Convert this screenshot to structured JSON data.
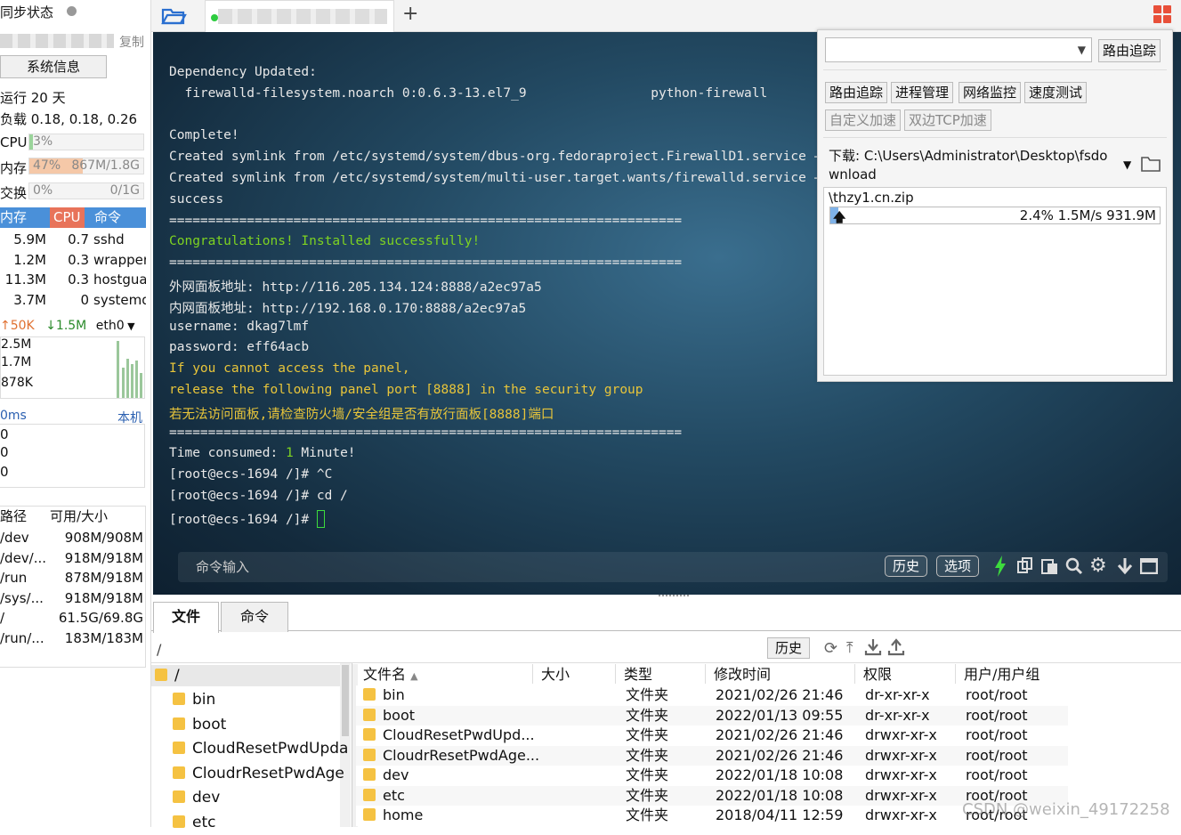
{
  "left": {
    "sync_label": "同步状态",
    "copy_label": "复制",
    "sysinfo_button": "系统信息",
    "uptime": "运行 20 天",
    "load": "负载 0.18, 0.18, 0.26",
    "cpu": {
      "label": "CPU",
      "value": "3%",
      "percent": 3
    },
    "mem": {
      "label": "内存",
      "value": "47%",
      "detail": "867M/1.8G",
      "percent": 47
    },
    "swap": {
      "label": "交换",
      "value": "0%",
      "detail": "0/1G",
      "percent": 0
    },
    "proc_headers": [
      "内存",
      "CPU",
      "命令"
    ],
    "processes": [
      {
        "mem": "5.9M",
        "cpu": "0.7",
        "cmd": "sshd"
      },
      {
        "mem": "1.2M",
        "cpu": "0.3",
        "cmd": "wrapper"
      },
      {
        "mem": "11.3M",
        "cpu": "0.3",
        "cmd": "hostgua"
      },
      {
        "mem": "3.7M",
        "cpu": "0",
        "cmd": "systemd"
      }
    ],
    "net": {
      "up": "50K",
      "down": "1.5M",
      "iface": "eth0",
      "scale": [
        "2.5M",
        "1.7M",
        "878K"
      ]
    },
    "ping": {
      "label": "0ms",
      "target": "本机",
      "values": [
        "0",
        "0",
        "0"
      ]
    },
    "disk_headers": [
      "路径",
      "可用/大小"
    ],
    "disks": [
      {
        "path": "/dev",
        "size": "908M/908M"
      },
      {
        "path": "/dev/...",
        "size": "918M/918M"
      },
      {
        "path": "/run",
        "size": "878M/918M"
      },
      {
        "path": "/sys/...",
        "size": "918M/918M"
      },
      {
        "path": "/",
        "size": "61.5G/69.8G"
      },
      {
        "path": "/run/...",
        "size": "183M/183M"
      }
    ]
  },
  "tabbar": {
    "add": "+"
  },
  "terminal": {
    "lines": [
      {
        "text": "Dependency Updated:",
        "cls": ""
      },
      {
        "text": "  firewalld-filesystem.noarch 0:0.6.3-13.el7_9                python-firewall",
        "cls": ""
      },
      {
        "text": "",
        "cls": ""
      },
      {
        "text": "Complete!",
        "cls": ""
      },
      {
        "text": "Created symlink from /etc/systemd/system/dbus-org.fedoraproject.FirewallD1.service →",
        "cls": ""
      },
      {
        "text": "Created symlink from /etc/systemd/system/multi-user.target.wants/firewalld.service →",
        "cls": ""
      },
      {
        "text": "success",
        "cls": ""
      },
      {
        "text": "==================================================================",
        "cls": ""
      },
      {
        "text": "Congratulations! Installed successfully!",
        "cls": "green"
      },
      {
        "text": "==================================================================",
        "cls": ""
      },
      {
        "text": "外网面板地址: http://116.205.134.124:8888/a2ec97a5",
        "cls": ""
      },
      {
        "text": "内网面板地址: http://192.168.0.170:8888/a2ec97a5",
        "cls": ""
      },
      {
        "text": "username: dkag7lmf",
        "cls": ""
      },
      {
        "text": "password: eff64acb",
        "cls": ""
      },
      {
        "text": "If you cannot access the panel,",
        "cls": "yellow"
      },
      {
        "text": "release the following panel port [8888] in the security group",
        "cls": "yellow"
      },
      {
        "text": "若无法访问面板,请检查防火墙/安全组是否有放行面板[8888]端口",
        "cls": "yellow"
      },
      {
        "text": "==================================================================",
        "cls": ""
      },
      {
        "text": "Time consumed: 1 Minute!",
        "cls": "time"
      },
      {
        "text": "[root@ecs-1694 /]# ^C",
        "cls": ""
      },
      {
        "text": "[root@ecs-1694 /]# cd /",
        "cls": ""
      },
      {
        "text": "[root@ecs-1694 /]# ",
        "cls": "prompt"
      }
    ],
    "cmd_placeholder": "命令输入",
    "history_button": "历史",
    "options_button": "选项"
  },
  "popup": {
    "trace_button": "路由追踪",
    "tools": [
      "路由追踪",
      "进程管理",
      "网络监控",
      "速度测试"
    ],
    "tools2": [
      "自定义加速",
      "双边TCP加速"
    ],
    "download_label": "下载: C:\\Users\\Administrator\\Desktop\\fsdownload",
    "file_name": "\\thzy1.cn.zip",
    "progress_text": "2.4% 1.5M/s 931.9M",
    "progress_percent": 2.4
  },
  "bottom": {
    "tabs": [
      "文件",
      "命令"
    ],
    "path": "/",
    "history_button": "历史",
    "tree_root": "/",
    "tree": [
      "bin",
      "boot",
      "CloudResetPwdUpda",
      "CloudrResetPwdAge",
      "dev",
      "etc"
    ],
    "columns": [
      "文件名",
      "大小",
      "类型",
      "修改时间",
      "权限",
      "用户/用户组"
    ],
    "files": [
      {
        "name": "bin",
        "size": "",
        "type": "文件夹",
        "mtime": "2021/02/26 21:46",
        "perm": "dr-xr-xr-x",
        "owner": "root/root"
      },
      {
        "name": "boot",
        "size": "",
        "type": "文件夹",
        "mtime": "2022/01/13 09:55",
        "perm": "dr-xr-xr-x",
        "owner": "root/root"
      },
      {
        "name": "CloudResetPwdUpd...",
        "size": "",
        "type": "文件夹",
        "mtime": "2021/02/26 21:46",
        "perm": "drwxr-xr-x",
        "owner": "root/root"
      },
      {
        "name": "CloudrResetPwdAge...",
        "size": "",
        "type": "文件夹",
        "mtime": "2021/02/26 21:46",
        "perm": "drwxr-xr-x",
        "owner": "root/root"
      },
      {
        "name": "dev",
        "size": "",
        "type": "文件夹",
        "mtime": "2022/01/18 10:08",
        "perm": "drwxr-xr-x",
        "owner": "root/root"
      },
      {
        "name": "etc",
        "size": "",
        "type": "文件夹",
        "mtime": "2022/01/18 10:08",
        "perm": "drwxr-xr-x",
        "owner": "root/root"
      },
      {
        "name": "home",
        "size": "",
        "type": "文件夹",
        "mtime": "2018/04/11 12:59",
        "perm": "drwxr-xr-x",
        "owner": "root/root"
      }
    ],
    "watermark": "CSDN @weixin_49172258"
  }
}
